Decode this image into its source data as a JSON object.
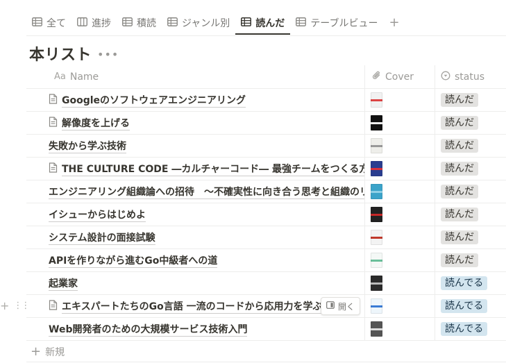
{
  "tabs": [
    {
      "label": "全て",
      "icon": "table-icon"
    },
    {
      "label": "進捗",
      "icon": "board-icon"
    },
    {
      "label": "積読",
      "icon": "table-icon"
    },
    {
      "label": "ジャンル別",
      "icon": "table-icon"
    },
    {
      "label": "読んだ",
      "icon": "table-icon",
      "active": true
    },
    {
      "label": "テーブルビュー",
      "icon": "table-icon"
    }
  ],
  "tab_add": "+",
  "title": "本リスト",
  "more": "•••",
  "columns": {
    "name": {
      "label": "Name",
      "icon_text": "Aa"
    },
    "cover": {
      "label": "Cover",
      "icon": "paperclip-icon"
    },
    "status": {
      "label": "status",
      "icon": "status-icon"
    }
  },
  "rows": [
    {
      "name": "Googleのソフトウェアエンジニアリング",
      "page_icon": true,
      "status": "読んだ",
      "status_color": "gray",
      "cover_color": "#f1f1f1",
      "cover_accent": "#d44"
    },
    {
      "name": "解像度を上げる",
      "page_icon": true,
      "status": "読んだ",
      "status_color": "gray",
      "cover_color": "#111111",
      "cover_accent": "#eeeeee"
    },
    {
      "name": "失敗から学ぶ技術",
      "page_icon": false,
      "status": "読んだ",
      "status_color": "gray",
      "cover_color": "#eeeeea",
      "cover_accent": "#999999"
    },
    {
      "name": "THE CULTURE CODE ―カルチャーコード― 最強チームをつくる方法",
      "page_icon": true,
      "status": "読んだ",
      "status_color": "gray",
      "cover_color": "#2a3d8f",
      "cover_accent": "#d8323c"
    },
    {
      "name": "エンジニアリング組織論への招待　～不確実性に向き合う思考と組織のリ",
      "page_icon": false,
      "status": "読んだ",
      "status_color": "gray",
      "cover_color": "#3ba3c9",
      "cover_accent": "#8fd0e6"
    },
    {
      "name": "イシューからはじめよ",
      "page_icon": false,
      "status": "読んだ",
      "status_color": "gray",
      "cover_color": "#222222",
      "cover_accent": "#c62828"
    },
    {
      "name": "システム設計の面接試験",
      "page_icon": false,
      "status": "読んだ",
      "status_color": "gray",
      "cover_color": "#f3f3f3",
      "cover_accent": "#c0392b"
    },
    {
      "name": "APIを作りながら進むGo中級者への道",
      "page_icon": false,
      "status": "読んだ",
      "status_color": "gray",
      "cover_color": "#f4f8f6",
      "cover_accent": "#6abf9a"
    },
    {
      "name": "起業家",
      "page_icon": false,
      "status": "読んでる",
      "status_color": "blue",
      "cover_color": "#2b2b2b",
      "cover_accent": "#bbbbbb"
    },
    {
      "name": "エキスパートたちのGo言語 一流のコードから応用力を学ぶ",
      "page_icon": true,
      "status": "読んでる",
      "status_color": "blue",
      "cover_color": "#eef6fb",
      "cover_accent": "#3a7bd5"
    },
    {
      "name": "Web開発者のための大規模サービス技術入門",
      "page_icon": false,
      "status": "読んでる",
      "status_color": "blue",
      "cover_color": "#555555",
      "cover_accent": "#dddddd"
    }
  ],
  "open_button": {
    "label": "開く"
  },
  "new_row": {
    "label": "新規",
    "plus": "+"
  },
  "row_tools": {
    "plus": "+",
    "drag": "⋮⋮"
  }
}
